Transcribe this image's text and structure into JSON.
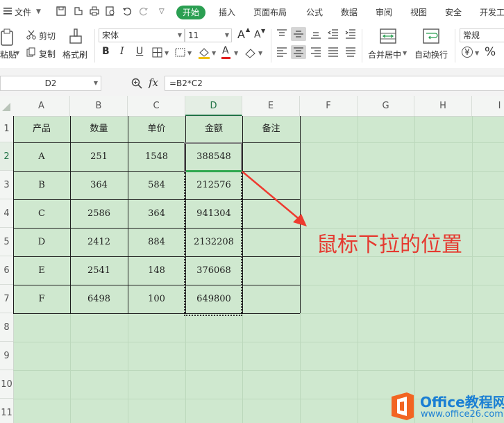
{
  "menubar": {
    "file_label": "文件",
    "tabs": [
      "开始",
      "插入",
      "页面布局",
      "公式",
      "数据",
      "审阅",
      "视图",
      "安全",
      "开发工"
    ]
  },
  "ribbon": {
    "paste": "粘贴",
    "cut": "剪切",
    "copy": "复制",
    "format_painter": "格式刷",
    "font_name": "宋体",
    "font_size": "11",
    "merge_center": "合并居中",
    "wrap_text": "自动换行",
    "number_format": "常规",
    "bold": "B",
    "italic": "I",
    "underline": "U",
    "font_color_letter": "A",
    "grow_font": "A",
    "shrink_font": "A",
    "percent": "%",
    "currency": "¥"
  },
  "formula_bar": {
    "name_box": "D2",
    "fx": "fx",
    "formula": "=B2*C2"
  },
  "sheet": {
    "columns": [
      "A",
      "B",
      "C",
      "D",
      "E",
      "F",
      "G",
      "H",
      "I"
    ],
    "rows": [
      "1",
      "2",
      "3",
      "4",
      "5",
      "6",
      "7",
      "8",
      "9",
      "10",
      "11"
    ],
    "header": [
      "产品",
      "数量",
      "单价",
      "金额",
      "备注"
    ],
    "data": [
      [
        "A",
        "251",
        "1548",
        "388548",
        ""
      ],
      [
        "B",
        "364",
        "584",
        "212576",
        ""
      ],
      [
        "C",
        "2586",
        "364",
        "941304",
        ""
      ],
      [
        "D",
        "2412",
        "884",
        "2132208",
        ""
      ],
      [
        "E",
        "2541",
        "148",
        "376068",
        ""
      ],
      [
        "F",
        "6498",
        "100",
        "649800",
        ""
      ]
    ],
    "selected_column": "D",
    "selected_row": "2"
  },
  "annotation": "鼠标下拉的位置",
  "watermark": {
    "title": "Office教程网",
    "url": "www.office26.com"
  },
  "colors": {
    "accent": "#2b9f52",
    "sheet_bg": "#cfe8cf",
    "annotation": "#e53a30",
    "watermark": "#1a7fd4"
  }
}
